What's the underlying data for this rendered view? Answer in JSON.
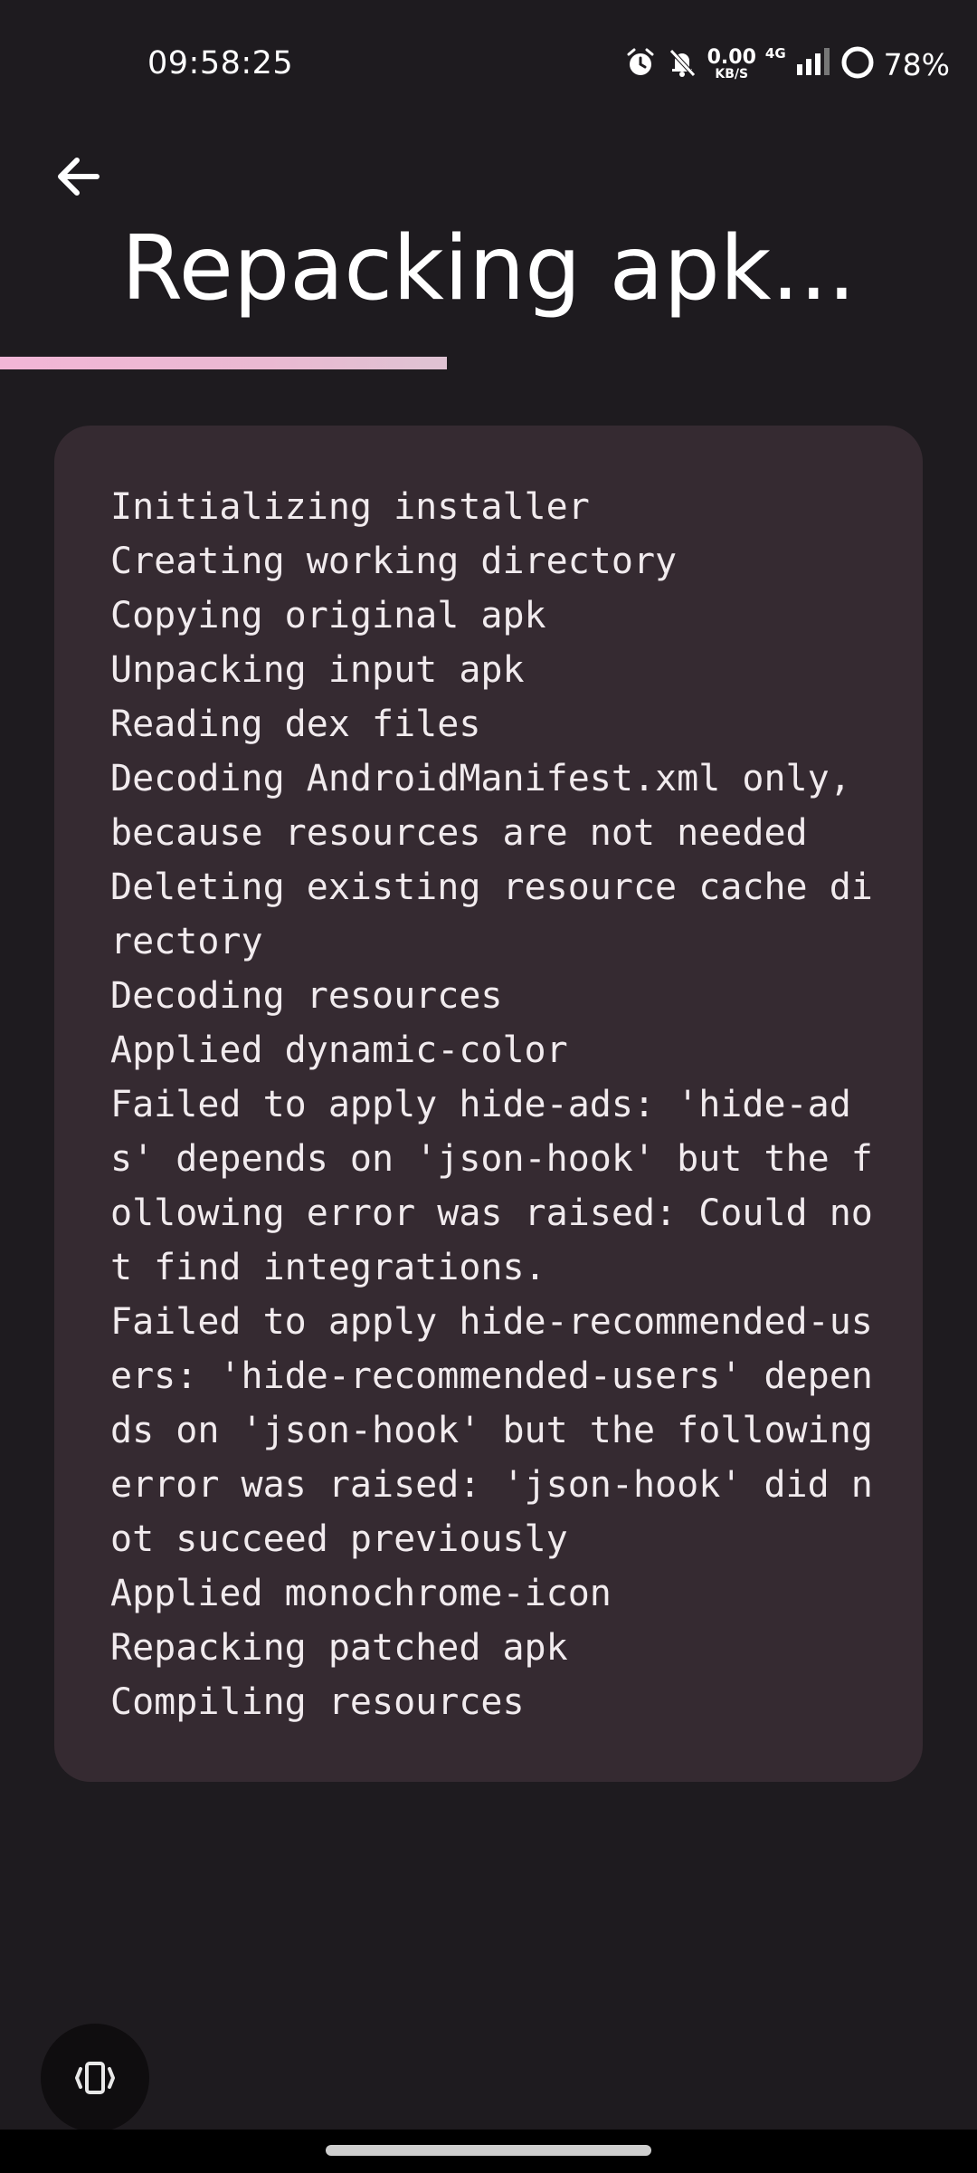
{
  "status_bar": {
    "time": "09:58:25",
    "net_speed_value": "0.00",
    "net_speed_unit": "KB/S",
    "network_type": "4G",
    "battery_percent": "78%",
    "icons": [
      "alarm-icon",
      "mute-icon",
      "signal-icon",
      "battery-icon"
    ]
  },
  "header": {
    "title": "Repacking apk..."
  },
  "progress": {
    "fraction": 0.457,
    "color": "#f2b6d6"
  },
  "log": {
    "lines": [
      "Initializing installer",
      "Creating working directory",
      "Copying original apk",
      "Unpacking input apk",
      "Reading dex files",
      "Decoding AndroidManifest.xml only, because resources are not needed",
      "Deleting existing resource cache directory",
      "Decoding resources",
      "Applied dynamic-color",
      "Failed to apply hide-ads: 'hide-ads' depends on 'json-hook' but the following error was raised: Could not find integrations.",
      "Failed to apply hide-recommended-users: 'hide-recommended-users' depends on 'json-hook' but the following error was raised: 'json-hook' did not succeed previously",
      "Applied monochrome-icon",
      "Repacking patched apk",
      "Compiling resources"
    ]
  },
  "colors": {
    "background": "#1e1b1f",
    "card": "#352a31",
    "accent": "#f2b6d6"
  },
  "fab": {
    "icon": "vibrate-icon"
  }
}
